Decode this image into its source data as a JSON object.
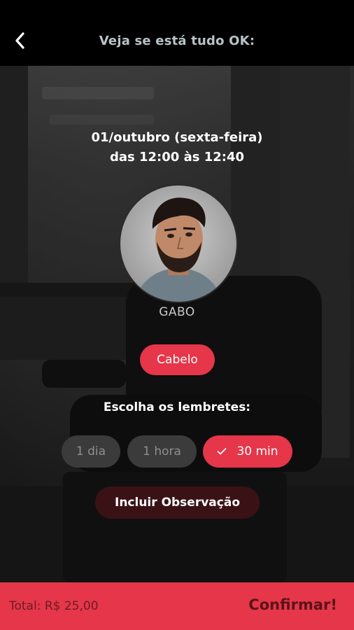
{
  "header": {
    "back_icon": "chevron-left-icon",
    "title": "Veja se está tudo OK:"
  },
  "appointment": {
    "date": "01/outubro (sexta-feira)",
    "time": "das 12:00 às 12:40"
  },
  "barber": {
    "name": "GABO"
  },
  "service": {
    "label": "Cabelo"
  },
  "reminders": {
    "title": "Escolha os lembretes:",
    "options": [
      {
        "label": "1 dia",
        "selected": false
      },
      {
        "label": "1 hora",
        "selected": false
      },
      {
        "label": "30 min",
        "selected": true
      }
    ],
    "check_icon": "check-icon"
  },
  "observation": {
    "label": "Incluir Observação"
  },
  "footer": {
    "total": "Total: R$ 25,00",
    "confirm": "Confirmar!"
  },
  "colors": {
    "accent": "#e5364a",
    "header_bg": "#000000",
    "chip_off": "#3b3b3b"
  }
}
